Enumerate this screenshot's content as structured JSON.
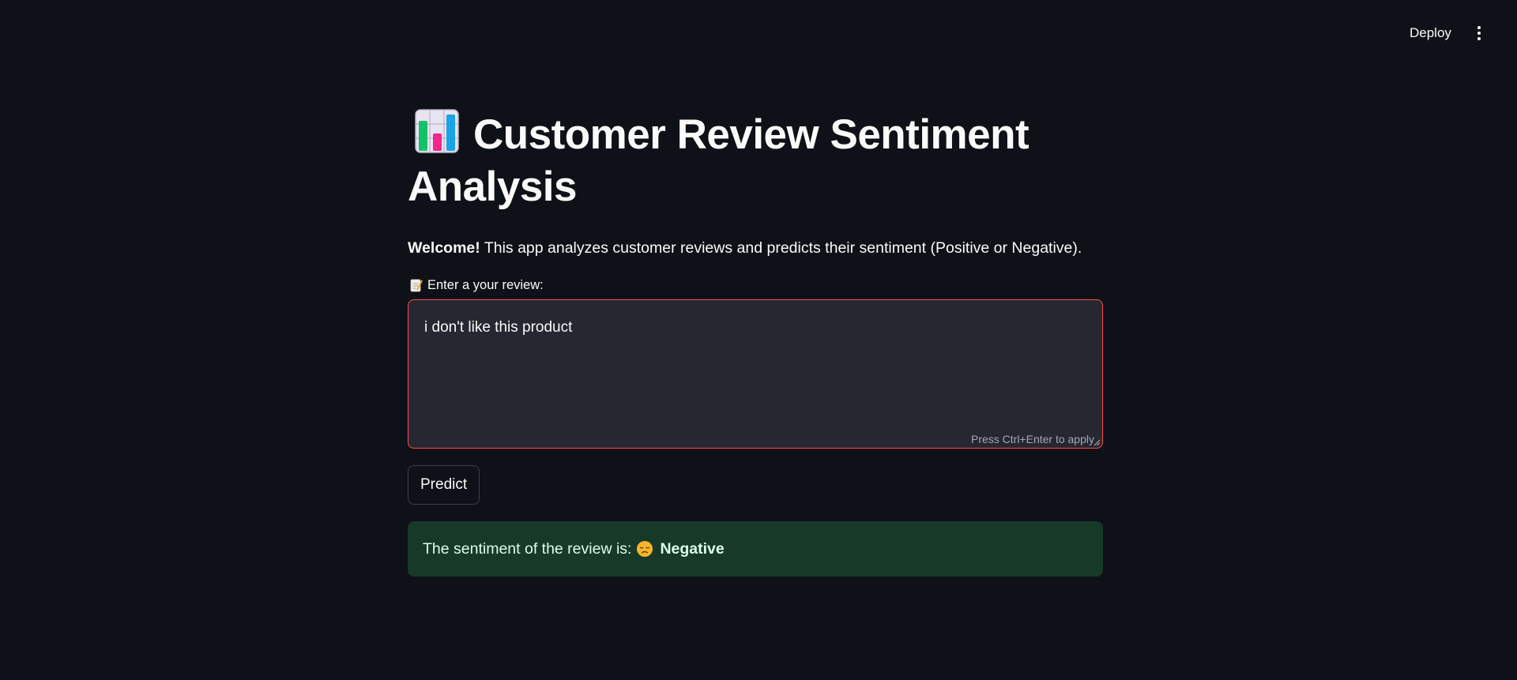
{
  "header": {
    "deploy_label": "Deploy",
    "menu_icon": "vertical-dots-icon"
  },
  "main": {
    "title_icon": "bar-chart-icon",
    "title": "Customer Review Sentiment Analysis",
    "welcome_bold": "Welcome!",
    "welcome_text": " This app analyzes customer reviews and predicts their sentiment (Positive or Negative).",
    "input_icon": "memo-icon",
    "input_label": "Enter a your review:",
    "review_value": "i don't like this product",
    "input_hint": "Press Ctrl+Enter to apply",
    "predict_label": "Predict",
    "result_prefix": "The sentiment of the review is:",
    "result_icon": "disappointed-face-icon",
    "result_value": "Negative"
  },
  "colors": {
    "background": "#0e1117",
    "input_border_focus": "#ff4b4b",
    "input_background": "#262730",
    "success_background": "#173928",
    "success_text": "#dffde9"
  }
}
